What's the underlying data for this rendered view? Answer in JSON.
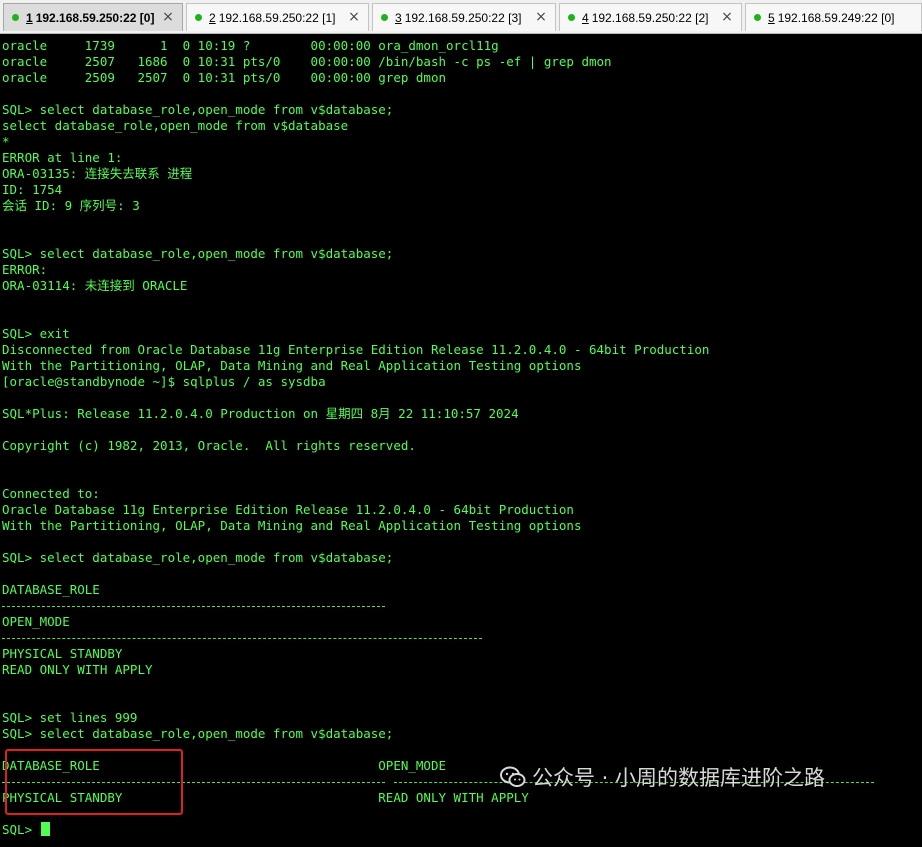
{
  "tabs": [
    {
      "num": "1",
      "label": "192.168.59.250:22 [0]",
      "active": true
    },
    {
      "num": "2",
      "label": "192.168.59.250:22 [1]",
      "active": false
    },
    {
      "num": "3",
      "label": "192.168.59.250:22 [3]",
      "active": false
    },
    {
      "num": "4",
      "label": "192.168.59.250:22 [2]",
      "active": false
    },
    {
      "num": "5",
      "label": "192.168.59.249:22 [0]",
      "active": false
    }
  ],
  "close_glyph": "×",
  "terminal": {
    "lines": [
      "oracle     1739      1  0 10:19 ?        00:00:00 ora_dmon_orcl11g",
      "oracle     2507   1686  0 10:31 pts/0    00:00:00 /bin/bash -c ps -ef | grep dmon",
      "oracle     2509   2507  0 10:31 pts/0    00:00:00 grep dmon",
      "",
      "SQL> select database_role,open_mode from v$database;",
      "select database_role,open_mode from v$database",
      "*",
      "ERROR at line 1:",
      "ORA-03135: 连接失去联系 进程",
      "ID: 1754",
      "会话 ID: 9 序列号: 3",
      "",
      "",
      "SQL> select database_role,open_mode from v$database;",
      "ERROR:",
      "ORA-03114: 未连接到 ORACLE",
      "",
      "",
      "SQL> exit",
      "Disconnected from Oracle Database 11g Enterprise Edition Release 11.2.0.4.0 - 64bit Production",
      "With the Partitioning, OLAP, Data Mining and Real Application Testing options",
      "[oracle@standbynode ~]$ sqlplus / as sysdba",
      "",
      "SQL*Plus: Release 11.2.0.4.0 Production on 星期四 8月 22 11:10:57 2024",
      "",
      "Copyright (c) 1982, 2013, Oracle.  All rights reserved.",
      "",
      "",
      "Connected to:",
      "Oracle Database 11g Enterprise Edition Release 11.2.0.4.0 - 64bit Production",
      "With the Partitioning, OLAP, Data Mining and Real Application Testing options",
      "",
      "SQL> select database_role,open_mode from v$database;",
      "",
      "DATABASE_ROLE",
      "",
      "OPEN_MODE",
      "",
      "PHYSICAL STANDBY",
      "READ ONLY WITH APPLY",
      "",
      "",
      "SQL> set lines 999",
      "SQL> select database_role,open_mode from v$database;",
      "",
      "DATABASE_ROLE                                     OPEN_MODE",
      "",
      "PHYSICAL STANDBY                                  READ ONLY WITH APPLY",
      "",
      "SQL> "
    ]
  },
  "watermark": {
    "text": "公众号 · 小周的数据库进阶之路",
    "icon": "wechat-icon"
  },
  "colors": {
    "terminal_text": "#4fff4f",
    "terminal_bg": "#000000",
    "highlight_border": "#e0201c",
    "tab_status_dot": "#1db31d"
  }
}
